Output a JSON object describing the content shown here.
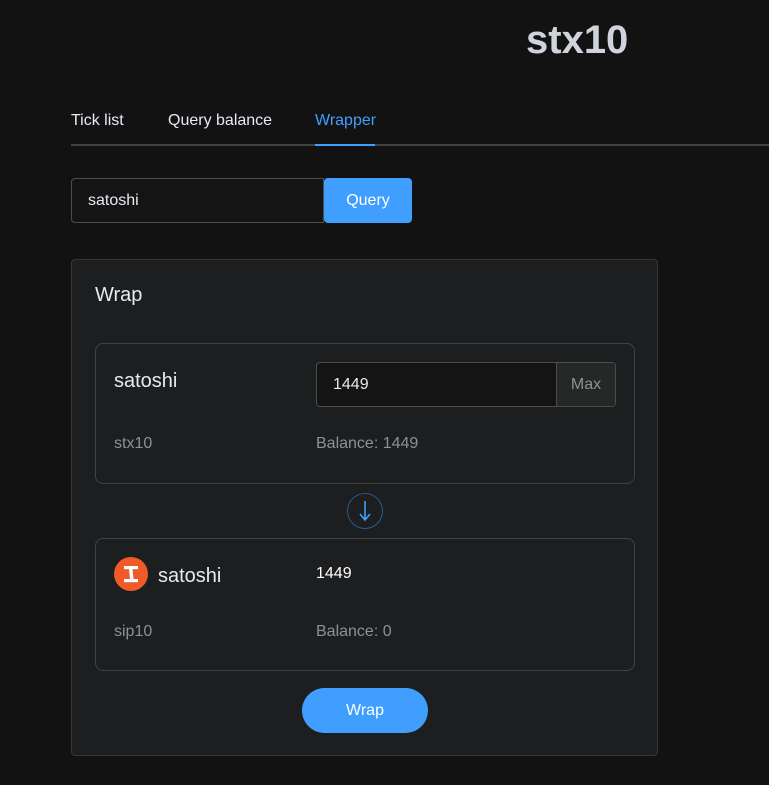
{
  "app": {
    "title": "stx10"
  },
  "tabs": [
    {
      "label": "Tick list"
    },
    {
      "label": "Query balance"
    },
    {
      "label": "Wrapper"
    }
  ],
  "active_tab": "Wrapper",
  "search": {
    "value": "satoshi",
    "button_label": "Query"
  },
  "wrap": {
    "title": "Wrap",
    "from": {
      "token_name": "satoshi",
      "token_type": "stx10",
      "amount": "1449",
      "max_label": "Max",
      "balance": "Balance: 1449"
    },
    "arrow_icon": "arrow-down-icon",
    "to": {
      "token_name": "satoshi",
      "token_type": "sip10",
      "amount": "1449",
      "balance": "Balance: 0",
      "logo_icon": "satoshi-token-logo"
    },
    "button_label": "Wrap"
  },
  "colors": {
    "background": "#121212",
    "card": "#1d1e1f",
    "accent": "#409eff",
    "logo": "#f05a28"
  }
}
